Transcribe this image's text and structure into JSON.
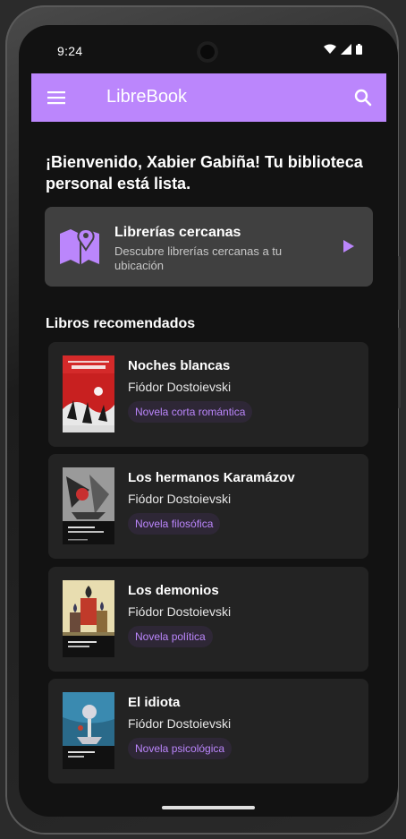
{
  "status": {
    "time": "9:24"
  },
  "app": {
    "title": "LibreBook"
  },
  "welcome": {
    "text": "¡Bienvenido, Xabier Gabiña! Tu biblioteca personal está lista."
  },
  "nearby": {
    "title": "Librerías cercanas",
    "description": "Descubre librerías cercanas a tu ubicación"
  },
  "recommended": {
    "title": "Libros recomendados",
    "books": [
      {
        "title": "Noches blancas",
        "author": "Fiódor Dostoievski",
        "genre": "Novela corta romántica"
      },
      {
        "title": "Los hermanos Karamázov",
        "author": "Fiódor Dostoievski",
        "genre": "Novela filosófica"
      },
      {
        "title": "Los demonios",
        "author": "Fiódor Dostoievski",
        "genre": "Novela política"
      },
      {
        "title": "El idiota",
        "author": "Fiódor Dostoievski",
        "genre": "Novela psicológica"
      }
    ]
  },
  "colors": {
    "accent": "#bb86fc",
    "background": "#121212",
    "card": "#232323",
    "nearby_card": "#404040"
  }
}
